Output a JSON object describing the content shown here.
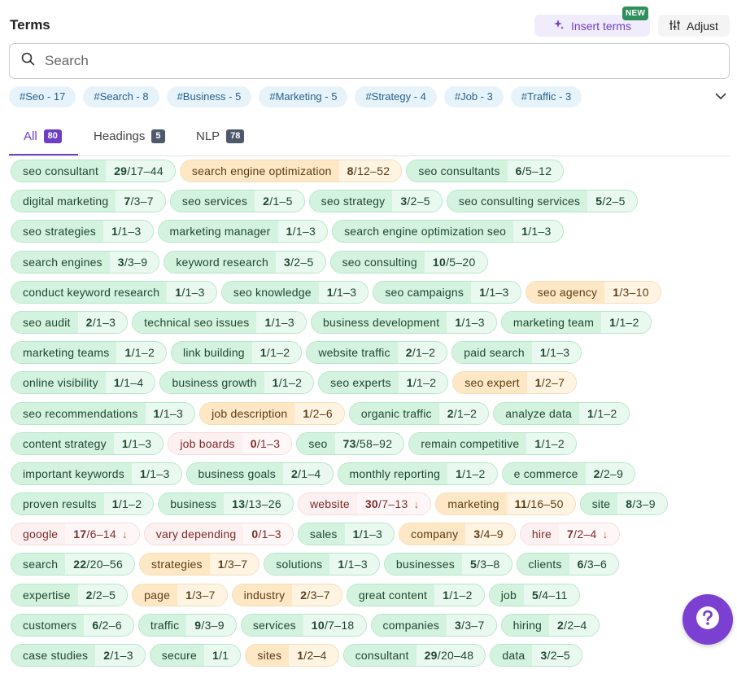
{
  "header": {
    "title": "Terms",
    "insert_label": "Insert terms",
    "new_badge": "NEW",
    "adjust_label": "Adjust"
  },
  "search": {
    "placeholder": "Search"
  },
  "hashtags": [
    "#Seo - 17",
    "#Search - 8",
    "#Business - 5",
    "#Marketing - 5",
    "#Strategy - 4",
    "#Job - 3",
    "#Traffic - 3"
  ],
  "tabs": [
    {
      "label": "All",
      "count": "80"
    },
    {
      "label": "Headings",
      "count": "5"
    },
    {
      "label": "NLP",
      "count": "78"
    }
  ],
  "colors": {
    "accent": "#6d3fc4",
    "green": "#d3f3df",
    "orange": "#fde7c5",
    "red": "#fdf0f0",
    "help": "#7b3fd1"
  },
  "terms": [
    [
      {
        "name": "seo consultant",
        "current": "29",
        "target": "/17–44",
        "status": "g"
      },
      {
        "name": "search engine optimization",
        "current": "8",
        "target": "/12–52",
        "status": "o"
      },
      {
        "name": "seo consultants",
        "current": "6",
        "target": "/5–12",
        "status": "g"
      }
    ],
    [
      {
        "name": "digital marketing",
        "current": "7",
        "target": "/3–7",
        "status": "g"
      },
      {
        "name": "seo services",
        "current": "2",
        "target": "/1–5",
        "status": "g"
      },
      {
        "name": "seo strategy",
        "current": "3",
        "target": "/2–5",
        "status": "g"
      },
      {
        "name": "seo consulting services",
        "current": "5",
        "target": "/2–5",
        "status": "g"
      }
    ],
    [
      {
        "name": "seo strategies",
        "current": "1",
        "target": "/1–3",
        "status": "g"
      },
      {
        "name": "marketing manager",
        "current": "1",
        "target": "/1–3",
        "status": "g"
      },
      {
        "name": "search engine optimization seo",
        "current": "1",
        "target": "/1–3",
        "status": "g"
      }
    ],
    [
      {
        "name": "search engines",
        "current": "3",
        "target": "/3–9",
        "status": "g"
      },
      {
        "name": "keyword research",
        "current": "3",
        "target": "/2–5",
        "status": "g"
      },
      {
        "name": "seo consulting",
        "current": "10",
        "target": "/5–20",
        "status": "g"
      }
    ],
    [
      {
        "name": "conduct keyword research",
        "current": "1",
        "target": "/1–3",
        "status": "g"
      },
      {
        "name": "seo knowledge",
        "current": "1",
        "target": "/1–3",
        "status": "g"
      },
      {
        "name": "seo campaigns",
        "current": "1",
        "target": "/1–3",
        "status": "g"
      },
      {
        "name": "seo agency",
        "current": "1",
        "target": "/3–10",
        "status": "o"
      }
    ],
    [
      {
        "name": "seo audit",
        "current": "2",
        "target": "/1–3",
        "status": "g"
      },
      {
        "name": "technical seo issues",
        "current": "1",
        "target": "/1–3",
        "status": "g"
      },
      {
        "name": "business development",
        "current": "1",
        "target": "/1–3",
        "status": "g"
      },
      {
        "name": "marketing team",
        "current": "1",
        "target": "/1–2",
        "status": "g"
      }
    ],
    [
      {
        "name": "marketing teams",
        "current": "1",
        "target": "/1–2",
        "status": "g"
      },
      {
        "name": "link building",
        "current": "1",
        "target": "/1–2",
        "status": "g"
      },
      {
        "name": "website traffic",
        "current": "2",
        "target": "/1–2",
        "status": "g"
      },
      {
        "name": "paid search",
        "current": "1",
        "target": "/1–3",
        "status": "g"
      }
    ],
    [
      {
        "name": "online visibility",
        "current": "1",
        "target": "/1–4",
        "status": "g"
      },
      {
        "name": "business growth",
        "current": "1",
        "target": "/1–2",
        "status": "g"
      },
      {
        "name": "seo experts",
        "current": "1",
        "target": "/1–2",
        "status": "g"
      },
      {
        "name": "seo expert",
        "current": "1",
        "target": "/2–7",
        "status": "o"
      }
    ],
    [
      {
        "name": "seo recommendations",
        "current": "1",
        "target": "/1–3",
        "status": "g"
      },
      {
        "name": "job description",
        "current": "1",
        "target": "/2–6",
        "status": "o"
      },
      {
        "name": "organic traffic",
        "current": "2",
        "target": "/1–2",
        "status": "g"
      },
      {
        "name": "analyze data",
        "current": "1",
        "target": "/1–2",
        "status": "g"
      }
    ],
    [
      {
        "name": "content strategy",
        "current": "1",
        "target": "/1–3",
        "status": "g"
      },
      {
        "name": "job boards",
        "current": "0",
        "target": "/1–3",
        "status": "r"
      },
      {
        "name": "seo",
        "current": "73",
        "target": "/58–92",
        "status": "g"
      },
      {
        "name": "remain competitive",
        "current": "1",
        "target": "/1–2",
        "status": "g"
      }
    ],
    [
      {
        "name": "important keywords",
        "current": "1",
        "target": "/1–3",
        "status": "g"
      },
      {
        "name": "business goals",
        "current": "2",
        "target": "/1–4",
        "status": "g"
      },
      {
        "name": "monthly reporting",
        "current": "1",
        "target": "/1–2",
        "status": "g"
      },
      {
        "name": "e commerce",
        "current": "2",
        "target": "/2–9",
        "status": "g"
      }
    ],
    [
      {
        "name": "proven results",
        "current": "1",
        "target": "/1–2",
        "status": "g"
      },
      {
        "name": "business",
        "current": "13",
        "target": "/13–26",
        "status": "g"
      },
      {
        "name": "website",
        "current": "30",
        "target": "/7–13",
        "status": "r",
        "arrow": "↓"
      },
      {
        "name": "marketing",
        "current": "11",
        "target": "/16–50",
        "status": "o"
      },
      {
        "name": "site",
        "current": "8",
        "target": "/3–9",
        "status": "g"
      }
    ],
    [
      {
        "name": "google",
        "current": "17",
        "target": "/6–14",
        "status": "r",
        "arrow": "↓"
      },
      {
        "name": "vary depending",
        "current": "0",
        "target": "/1–3",
        "status": "r"
      },
      {
        "name": "sales",
        "current": "1",
        "target": "/1–3",
        "status": "g"
      },
      {
        "name": "company",
        "current": "3",
        "target": "/4–9",
        "status": "o"
      },
      {
        "name": "hire",
        "current": "7",
        "target": "/2–4",
        "status": "r",
        "arrow": "↓"
      }
    ],
    [
      {
        "name": "search",
        "current": "22",
        "target": "/20–56",
        "status": "g"
      },
      {
        "name": "strategies",
        "current": "1",
        "target": "/3–7",
        "status": "o"
      },
      {
        "name": "solutions",
        "current": "1",
        "target": "/1–3",
        "status": "g"
      },
      {
        "name": "businesses",
        "current": "5",
        "target": "/3–8",
        "status": "g"
      },
      {
        "name": "clients",
        "current": "6",
        "target": "/3–6",
        "status": "g"
      }
    ],
    [
      {
        "name": "expertise",
        "current": "2",
        "target": "/2–5",
        "status": "g"
      },
      {
        "name": "page",
        "current": "1",
        "target": "/3–7",
        "status": "o"
      },
      {
        "name": "industry",
        "current": "2",
        "target": "/3–7",
        "status": "o"
      },
      {
        "name": "great content",
        "current": "1",
        "target": "/1–2",
        "status": "g"
      },
      {
        "name": "job",
        "current": "5",
        "target": "/4–11",
        "status": "g"
      }
    ],
    [
      {
        "name": "customers",
        "current": "6",
        "target": "/2–6",
        "status": "g"
      },
      {
        "name": "traffic",
        "current": "9",
        "target": "/3–9",
        "status": "g"
      },
      {
        "name": "services",
        "current": "10",
        "target": "/7–18",
        "status": "g"
      },
      {
        "name": "companies",
        "current": "3",
        "target": "/3–7",
        "status": "g"
      },
      {
        "name": "hiring",
        "current": "2",
        "target": "/2–4",
        "status": "g"
      }
    ],
    [
      {
        "name": "case studies",
        "current": "2",
        "target": "/1–3",
        "status": "g"
      },
      {
        "name": "secure",
        "current": "1",
        "target": "/1",
        "status": "g"
      },
      {
        "name": "sites",
        "current": "1",
        "target": "/2–4",
        "status": "o"
      },
      {
        "name": "consultant",
        "current": "29",
        "target": "/20–48",
        "status": "g"
      },
      {
        "name": "data",
        "current": "3",
        "target": "/2–5",
        "status": "g"
      }
    ]
  ]
}
